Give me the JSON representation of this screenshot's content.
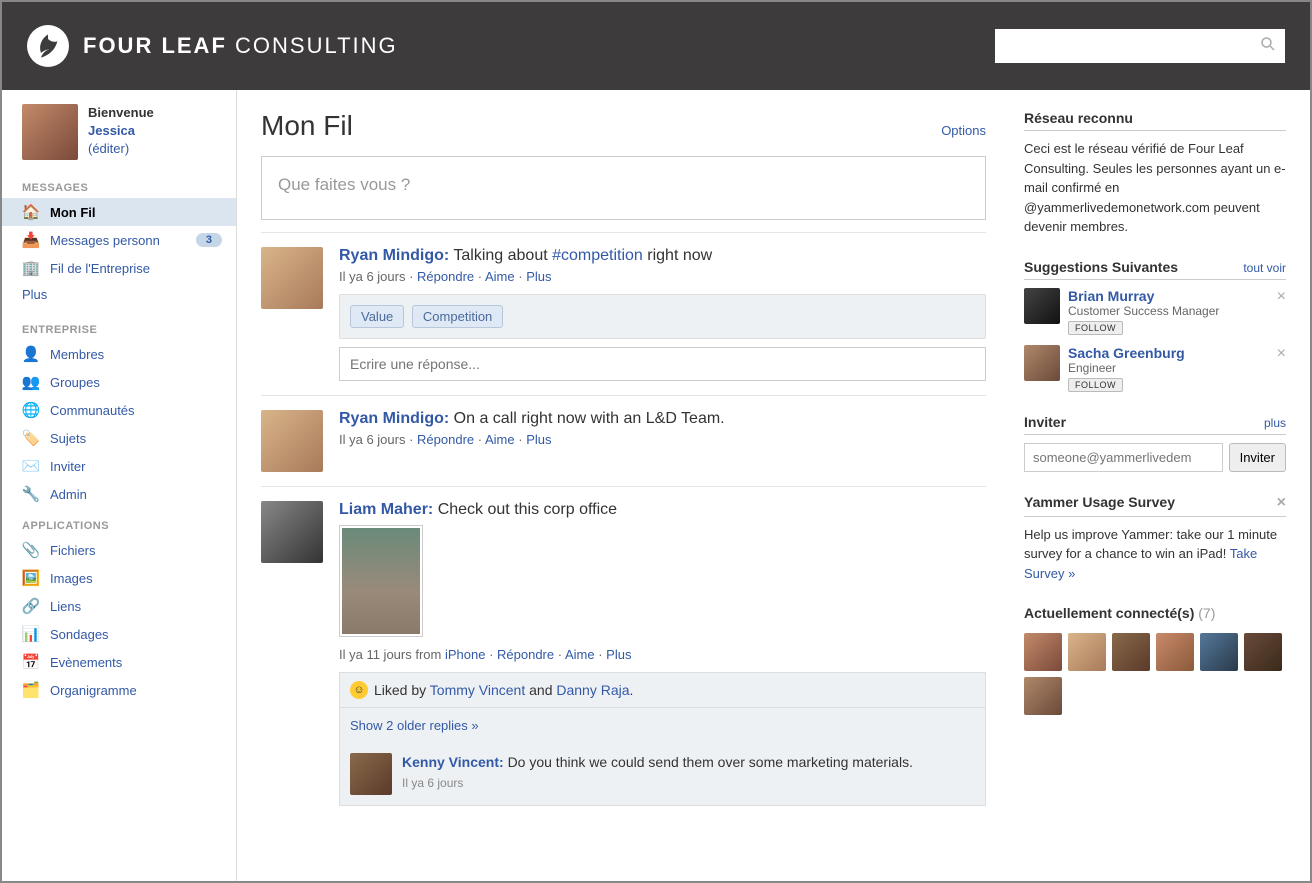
{
  "brand": {
    "bold": "FOUR LEAF",
    "light": "CONSULTING"
  },
  "sidebar": {
    "welcome": {
      "greeting": "Bienvenue",
      "name": "Jessica",
      "edit": "(éditer)"
    },
    "sections": {
      "messages": {
        "head": "MESSAGES",
        "items": [
          {
            "label": "Mon Fil",
            "active": true
          },
          {
            "label": "Messages personn",
            "badge": "3"
          },
          {
            "label": "Fil de l'Entreprise"
          }
        ],
        "more": "Plus"
      },
      "entreprise": {
        "head": "ENTREPRISE",
        "items": [
          {
            "label": "Membres"
          },
          {
            "label": "Groupes"
          },
          {
            "label": "Communautés"
          },
          {
            "label": "Sujets"
          },
          {
            "label": "Inviter"
          },
          {
            "label": "Admin"
          }
        ]
      },
      "applications": {
        "head": "APPLICATIONS",
        "items": [
          {
            "label": "Fichiers"
          },
          {
            "label": "Images"
          },
          {
            "label": "Liens"
          },
          {
            "label": "Sondages"
          },
          {
            "label": "Evènements"
          },
          {
            "label": "Organigramme"
          }
        ]
      }
    }
  },
  "feed": {
    "title": "Mon Fil",
    "options": "Options",
    "composer_placeholder": "Que faites vous ?",
    "reply_placeholder": "Ecrire une réponse...",
    "posts": [
      {
        "author": "Ryan Mindigo",
        "text_pre": "Talking about ",
        "hashtag": "#competition",
        "text_post": " right now",
        "meta": "Il ya 6 jours",
        "actions": {
          "reply": "Répondre",
          "like": "Aime",
          "more": "Plus"
        },
        "tags": [
          "Value",
          "Competition"
        ]
      },
      {
        "author": "Ryan Mindigo",
        "text": "On a call right now with an L&D Team.",
        "meta": "Il ya 6 jours",
        "actions": {
          "reply": "Répondre",
          "like": "Aime",
          "more": "Plus"
        }
      },
      {
        "author": "Liam Maher",
        "text": "Check out this corp office",
        "meta_full": "Il ya 11 jours from ",
        "meta_source": "iPhone",
        "actions": {
          "reply": "Répondre",
          "like": "Aime",
          "more": "Plus"
        },
        "liked_by_pre": "Liked by ",
        "liked_by_1": "Tommy Vincent",
        "liked_by_mid": " and ",
        "liked_by_2": "Danny  Raja",
        "older": "Show 2 older replies »",
        "reply": {
          "author": "Kenny Vincent",
          "text": "Do you think we could send them over some marketing materials.",
          "meta": "Il ya 6 jours"
        }
      }
    ]
  },
  "right": {
    "network": {
      "head": "Réseau reconnu",
      "body": "Ceci est le réseau vérifié de Four Leaf Consulting. Seules les personnes ayant un e-mail confirmé en @yammerlivedemonetwork.com peuvent devenir membres."
    },
    "suggestions": {
      "head": "Suggestions Suivantes",
      "all": "tout voir",
      "items": [
        {
          "name": "Brian Murray",
          "role": "Customer Success Manager"
        },
        {
          "name": "Sacha Greenburg",
          "role": "Engineer"
        }
      ],
      "follow": "FOLLOW"
    },
    "invite": {
      "head": "Inviter",
      "plus": "plus",
      "placeholder": "someone@yammerlivedem",
      "button": "Inviter"
    },
    "survey": {
      "head": "Yammer Usage Survey",
      "body": "Help us improve Yammer: take our 1 minute survey for a chance to win an iPad! ",
      "link": "Take Survey »"
    },
    "online": {
      "head": "Actuellement connecté(s)",
      "count": "(7)"
    }
  }
}
